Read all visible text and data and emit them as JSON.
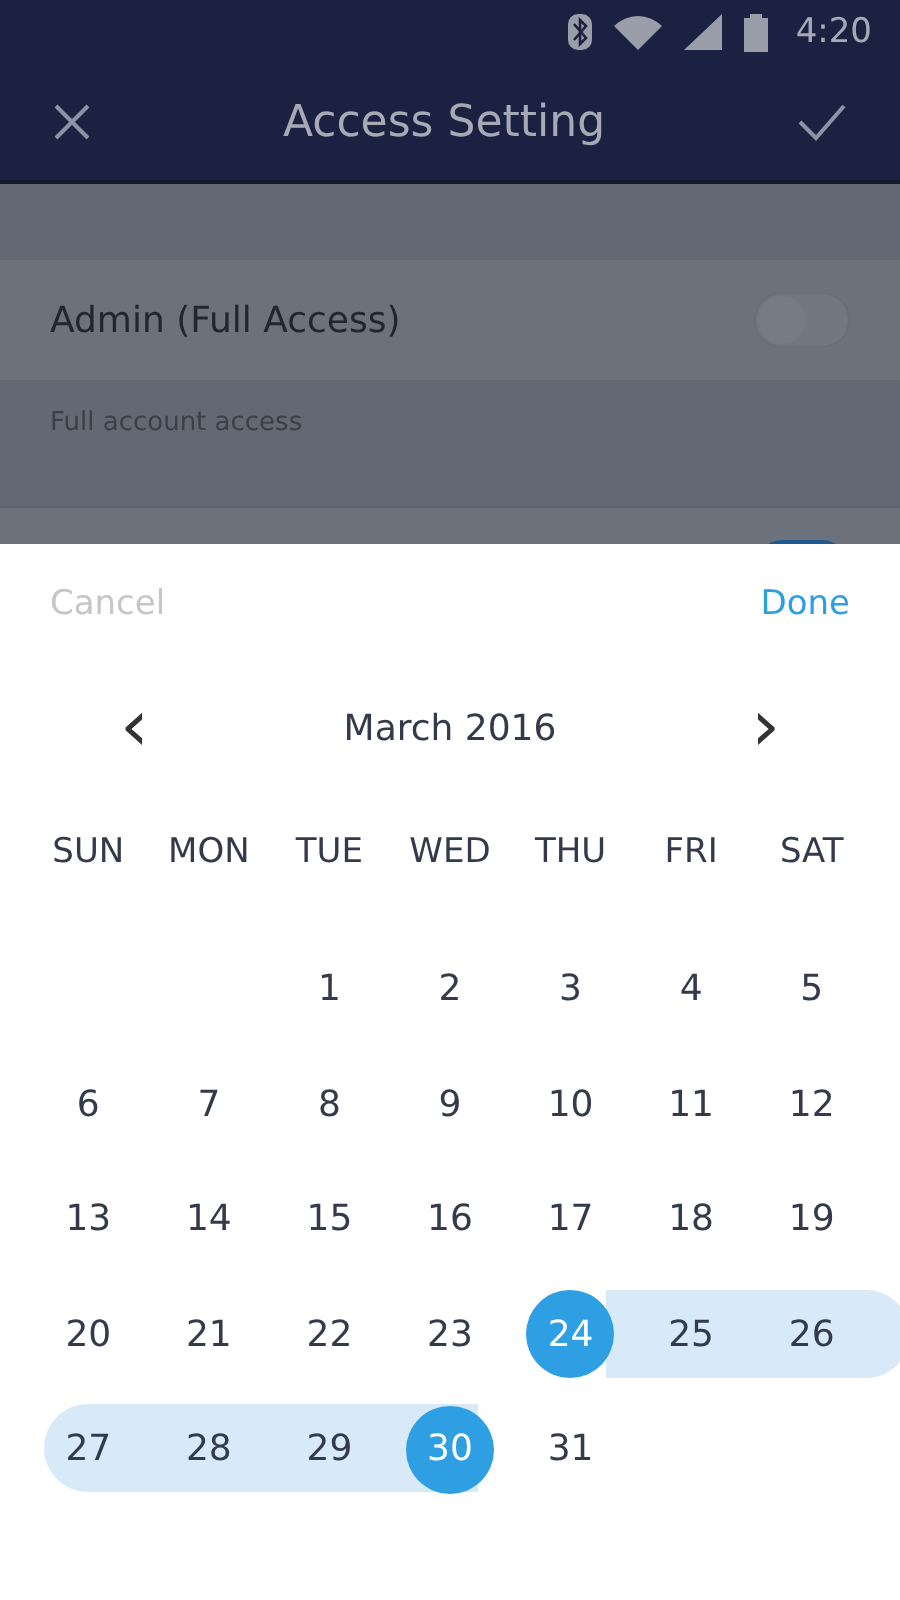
{
  "status_bar": {
    "time": "4:20"
  },
  "header": {
    "title": "Access Setting"
  },
  "settings": [
    {
      "label": "Admin (Full Access)",
      "description": "Full account access",
      "on": false
    },
    {
      "on": true
    }
  ],
  "picker": {
    "cancel": "Cancel",
    "done": "Done",
    "month": "March 2016",
    "prev": "‹",
    "next": "›",
    "weekdays": [
      "SUN",
      "MON",
      "TUE",
      "WED",
      "THU",
      "FRI",
      "SAT"
    ],
    "weeks": [
      [
        {
          "kind": "blank"
        },
        {
          "kind": "blank"
        },
        {
          "label": "1",
          "kind": "plain"
        },
        {
          "label": "2",
          "kind": "plain"
        },
        {
          "label": "3",
          "kind": "plain"
        },
        {
          "label": "4",
          "kind": "plain"
        },
        {
          "label": "5",
          "kind": "plain"
        }
      ],
      [
        {
          "label": "6",
          "kind": "plain"
        },
        {
          "label": "7",
          "kind": "plain"
        },
        {
          "label": "8",
          "kind": "plain"
        },
        {
          "label": "9",
          "kind": "plain"
        },
        {
          "label": "10",
          "kind": "plain"
        },
        {
          "label": "11",
          "kind": "plain"
        },
        {
          "label": "12",
          "kind": "plain"
        }
      ],
      [
        {
          "label": "13",
          "kind": "plain"
        },
        {
          "label": "14",
          "kind": "plain"
        },
        {
          "label": "15",
          "kind": "plain"
        },
        {
          "label": "16",
          "kind": "plain"
        },
        {
          "label": "17",
          "kind": "plain"
        },
        {
          "label": "18",
          "kind": "plain"
        },
        {
          "label": "19",
          "kind": "plain"
        }
      ],
      [
        {
          "label": "20",
          "kind": "plain"
        },
        {
          "label": "21",
          "kind": "plain"
        },
        {
          "label": "22",
          "kind": "plain"
        },
        {
          "label": "23",
          "kind": "plain"
        },
        {
          "label": "24",
          "kind": "start"
        },
        {
          "label": "25",
          "kind": "middle"
        },
        {
          "label": "26",
          "kind": "middle"
        }
      ],
      [
        {
          "label": "27",
          "kind": "middle"
        },
        {
          "label": "28",
          "kind": "middle"
        },
        {
          "label": "29",
          "kind": "middle"
        },
        {
          "label": "30",
          "kind": "end"
        },
        {
          "label": "31",
          "kind": "plain"
        }
      ]
    ]
  }
}
